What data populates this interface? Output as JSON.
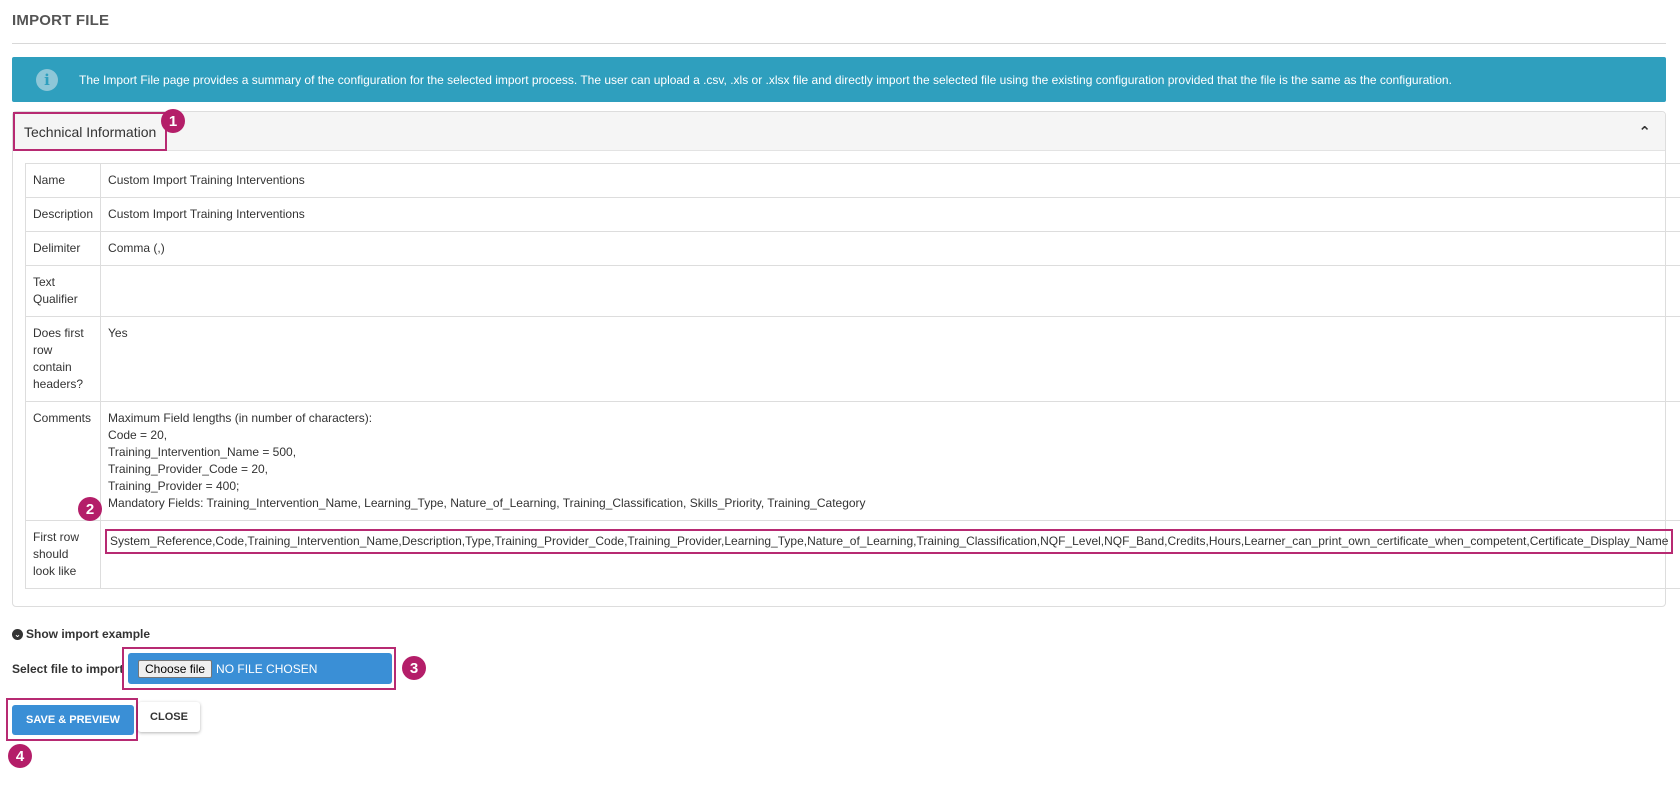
{
  "page": {
    "title": "IMPORT FILE",
    "info_text": "The Import File page provides a summary of the configuration for the selected import process. The user can upload a .csv, .xls or .xlsx file and directly import the selected file using the existing configuration provided that the file is the same as the configuration."
  },
  "panel": {
    "title": "Technical Information"
  },
  "rows": {
    "name": {
      "label": "Name",
      "value": "Custom Import Training Interventions"
    },
    "description": {
      "label": "Description",
      "value": "Custom Import Training Interventions"
    },
    "delimiter": {
      "label": "Delimiter",
      "value": "Comma (,)"
    },
    "text_qualifier": {
      "label": "Text Qualifier",
      "value": ""
    },
    "first_row_headers": {
      "label": "Does first row contain headers?",
      "value": "Yes"
    },
    "comments": {
      "label": "Comments",
      "lines": [
        "Maximum Field lengths (in number of characters):",
        "Code = 20,",
        "Training_Intervention_Name = 500,",
        "Training_Provider_Code = 20,",
        "Training_Provider = 400;",
        "Mandatory Fields: Training_Intervention_Name, Learning_Type, Nature_of_Learning, Training_Classification, Skills_Priority, Training_Category"
      ]
    },
    "first_row_example": {
      "label": "First row should look like",
      "value": "System_Reference,Code,Training_Intervention_Name,Description,Type,Training_Provider_Code,Training_Provider,Learning_Type,Nature_of_Learning,Training_Classification,NQF_Level,NQF_Band,Credits,Hours,Learner_can_print_own_certificate_when_competent,Certificate_Display_Name"
    }
  },
  "example_toggle": "Show import example",
  "file_select": {
    "label": "Select file to import",
    "choose_label": "Choose file",
    "status": "NO FILE CHOSEN"
  },
  "buttons": {
    "save_preview": "SAVE & PREVIEW",
    "close": "CLOSE"
  },
  "badges": [
    "1",
    "2",
    "3",
    "4"
  ],
  "colors": {
    "banner": "#2f9fbe",
    "highlight": "#b72a72",
    "badge": "#b41e69",
    "primary_button": "#3a8fd6"
  }
}
